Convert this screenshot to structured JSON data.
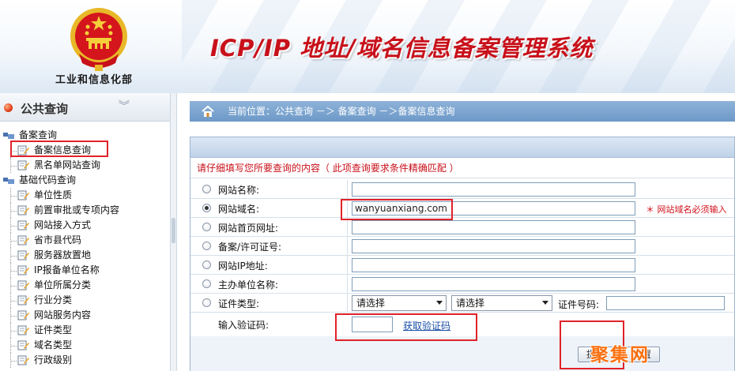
{
  "header": {
    "ministry": "工业和信息化部",
    "system_title": "ICP/IP 地址/域名信息备案管理系统"
  },
  "sidebar": {
    "title": "公共查询",
    "groups": [
      {
        "label": "备案查询",
        "items": [
          "备案信息查询",
          "黑名单网站查询"
        ]
      },
      {
        "label": "基础代码查询",
        "items": [
          "单位性质",
          "前置审批或专项内容",
          "网站接入方式",
          "省市县代码",
          "服务器放置地",
          "IP报备单位名称",
          "单位所属分类",
          "行业分类",
          "网站服务内容",
          "证件类型",
          "域名类型",
          "行政级别"
        ]
      }
    ]
  },
  "breadcrumb": "当前位置：公共查询  －＞  备案查询  －＞备案信息查询",
  "form": {
    "instruction": "请仔细填写您所要查询的内容（ 此项查询要求条件精确匹配 ）",
    "fields": [
      {
        "label": "网站名称:",
        "value": ""
      },
      {
        "label": "网站域名:",
        "value": "wanyuanxiang.com"
      },
      {
        "label": "网站首页网址:",
        "value": ""
      },
      {
        "label": "备案/许可证号:",
        "value": ""
      },
      {
        "label": "网站IP地址:",
        "value": ""
      },
      {
        "label": "主办单位名称:",
        "value": ""
      }
    ],
    "domain_hint": "＊ 网站域名必须输入",
    "cert_type_label": "证件类型:",
    "select1": "请选择",
    "select2": "请选择",
    "cert_no_label": "证件号码:",
    "captcha_label": "输入验证码:",
    "captcha_link": "获取验证码",
    "submit": "提交",
    "reset": "重置"
  },
  "watermark": "聚集网",
  "colors": {
    "title_red": "#c8101a",
    "highlight_red": "#e0222a",
    "crumb_blue": "#7aa3cf"
  }
}
